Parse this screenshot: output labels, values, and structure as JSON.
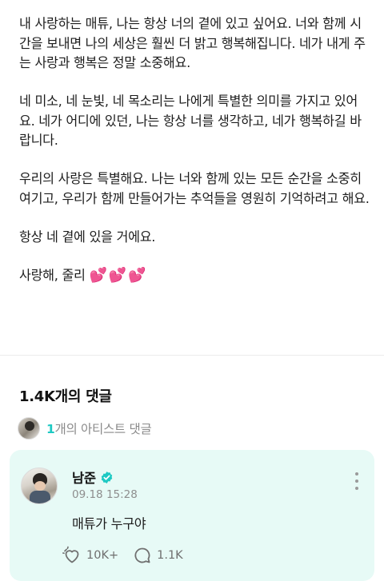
{
  "post": {
    "paragraphs": [
      "내 사랑하는 매튜, 나는 항상 너의 곁에 있고 싶어요. 너와 함께 시간을 보내면 나의 세상은 훨씬 더 밝고 행복해집니다. 네가 내게 주는 사랑과 행복은 정말 소중해요.",
      "네 미소, 네 눈빛, 네 목소리는 나에게 특별한 의미를 가지고 있어요. 네가 어디에 있던, 나는 항상 너를 생각하고, 네가 행복하길 바랍니다.",
      "우리의 사랑은 특별해요. 나는 너와 함께 있는 모든 순간을 소중히 여기고, 우리가 함께 만들어가는 추억들을 영원히 기억하려고 해요.",
      "항상 네 곁에 있을 거에요."
    ],
    "closing": "사랑해, 줄리",
    "hearts": "💕💕💕"
  },
  "comments": {
    "title": "1.4K개의 댓글",
    "artist_count": "1",
    "artist_label": "개의 아티스트 댓글"
  },
  "featured_comment": {
    "author": "남준",
    "date": "09.18 15:28",
    "text": "매튜가 누구야",
    "likes": "10K+",
    "replies": "1.1K"
  },
  "colors": {
    "accent": "#1ec9c3",
    "card_bg": "#e7faf6",
    "heart": "#ff3d9a"
  },
  "icons": {
    "verified": "verified-badge-icon",
    "more": "more-vertical-icon",
    "like": "like-heart-icon",
    "reply": "reply-bubble-icon"
  }
}
